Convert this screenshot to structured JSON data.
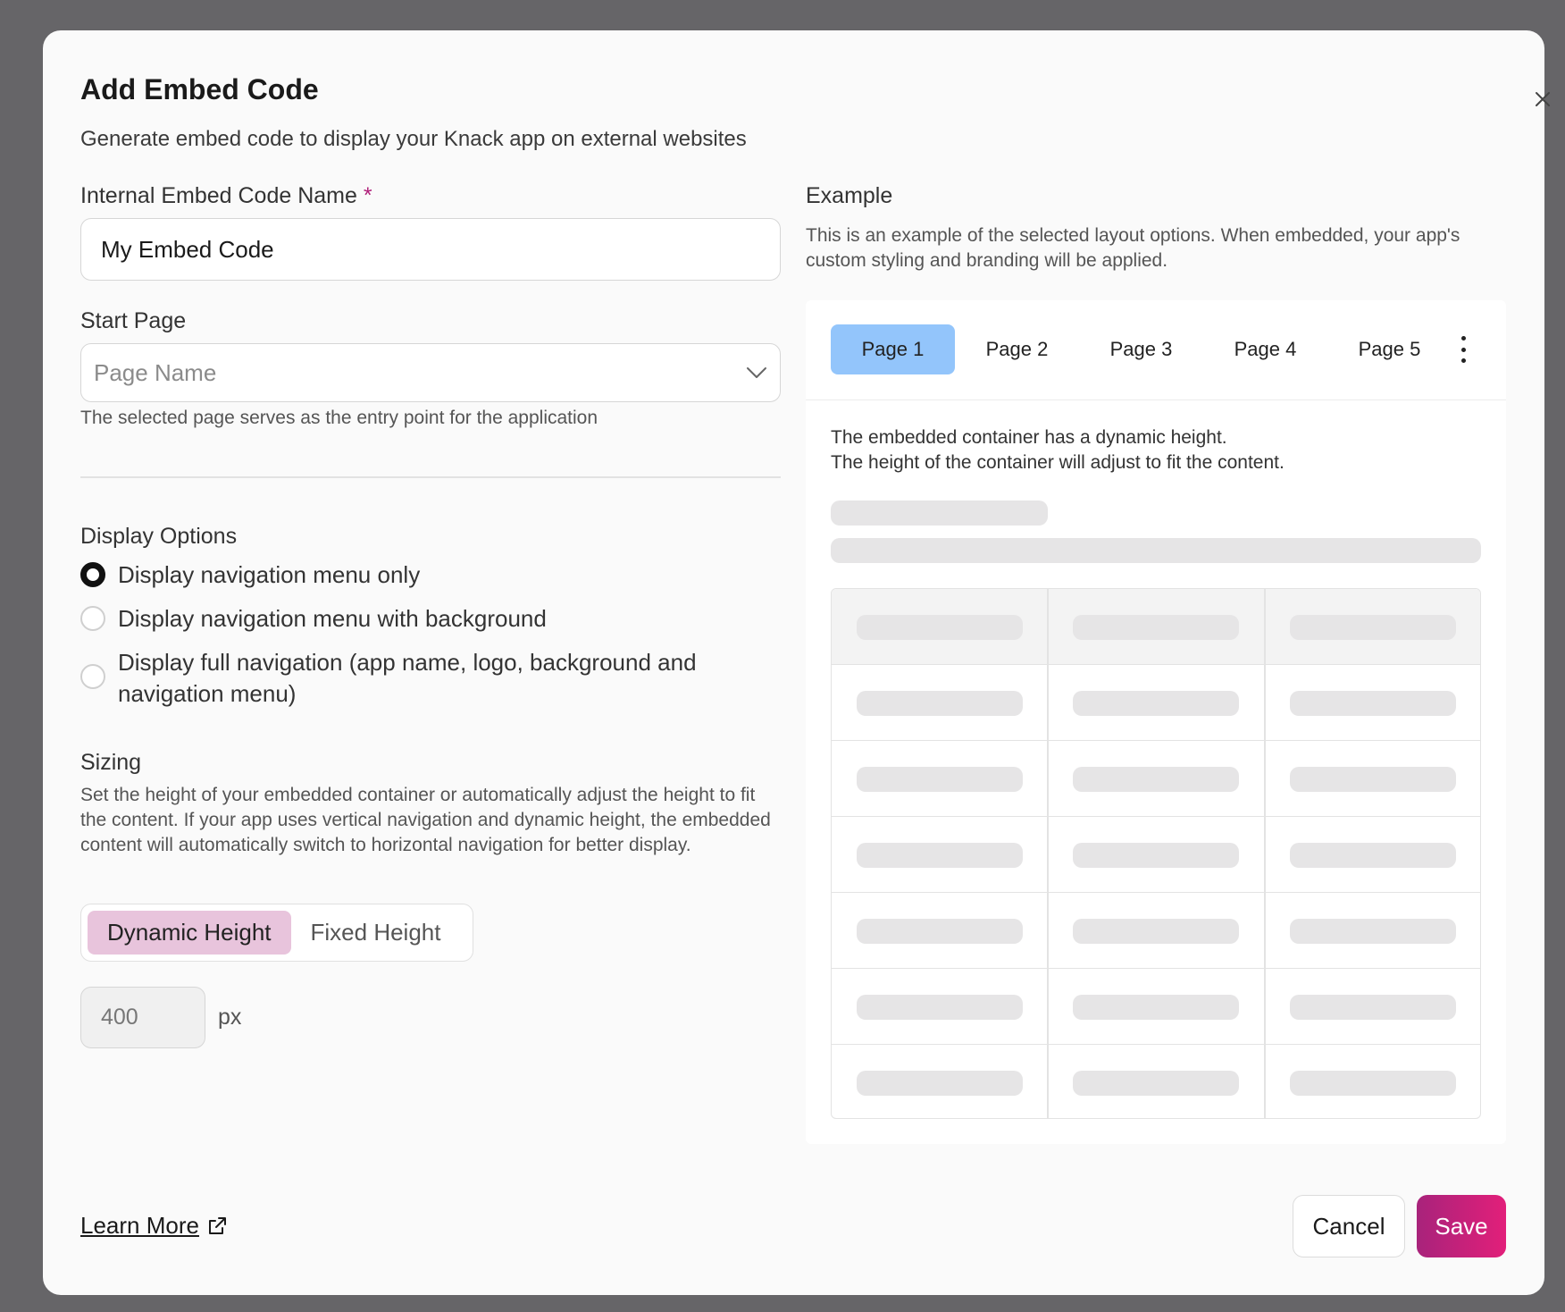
{
  "modal": {
    "title": "Add Embed Code",
    "subtitle": "Generate embed code to display your Knack app on external websites"
  },
  "form": {
    "name_label": "Internal Embed Code Name",
    "required_mark": "*",
    "name_value": "My Embed Code",
    "start_page_label": "Start Page",
    "start_page_placeholder": "Page Name",
    "start_page_hint": "The selected page serves as the entry point for the application",
    "display_options_label": "Display Options",
    "display_options": [
      {
        "label": "Display navigation menu only",
        "selected": true
      },
      {
        "label": "Display navigation menu with background",
        "selected": false
      },
      {
        "label": "Display full navigation (app name, logo, background and navigation menu)",
        "selected": false
      }
    ],
    "sizing_label": "Sizing",
    "sizing_desc": "Set the height of your embedded container or automatically adjust the height to fit the content. If your app uses vertical navigation and dynamic height, the embedded content will automatically switch to horizontal navigation for better display.",
    "sizing_options": [
      "Dynamic Height",
      "Fixed Height"
    ],
    "sizing_selected": "Dynamic Height",
    "height_value": "400",
    "height_unit": "px"
  },
  "example": {
    "title": "Example",
    "desc": "This is an example of the selected layout options. When embedded, your app's custom styling and branding will be applied.",
    "tabs": [
      "Page 1",
      "Page 2",
      "Page 3",
      "Page 4",
      "Page 5"
    ],
    "active_tab": "Page 1",
    "text_line1": "The embedded container has a dynamic height.",
    "text_line2": "The height of the container will adjust to fit the content."
  },
  "footer": {
    "learn_more": "Learn More",
    "cancel": "Cancel",
    "save": "Save"
  },
  "colors": {
    "primary_gradient_start": "#a8237b",
    "primary_gradient_end": "#e21f7a",
    "active_tab": "#93c5fb",
    "active_segment": "#e8c4dc"
  }
}
